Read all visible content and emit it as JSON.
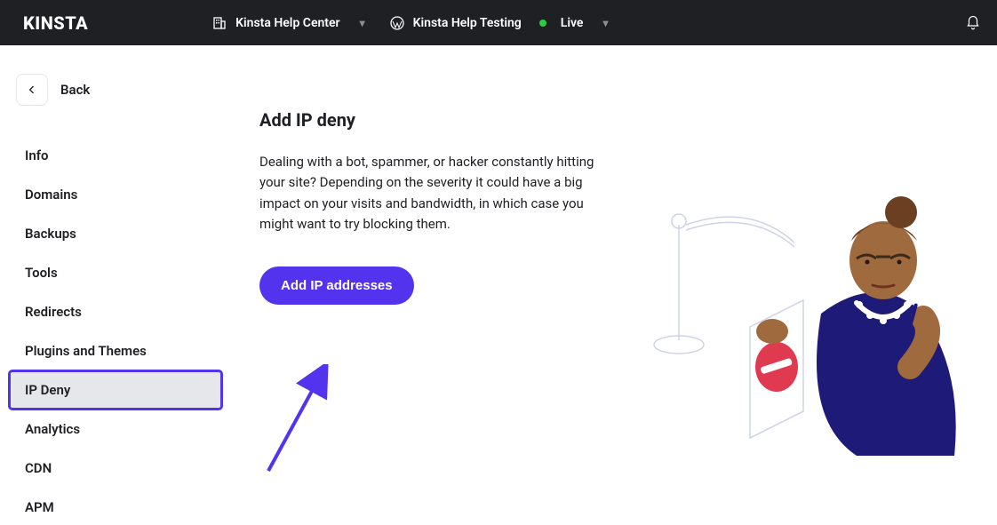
{
  "topbar": {
    "logo_text": "KINSTA",
    "company_selector": "Kinsta Help Center",
    "site_selector": "Kinsta Help Testing",
    "env_label": "Live"
  },
  "sidebar": {
    "back_label": "Back",
    "items": [
      {
        "label": "Info"
      },
      {
        "label": "Domains"
      },
      {
        "label": "Backups"
      },
      {
        "label": "Tools"
      },
      {
        "label": "Redirects"
      },
      {
        "label": "Plugins and Themes"
      },
      {
        "label": "IP Deny"
      },
      {
        "label": "Analytics"
      },
      {
        "label": "CDN"
      },
      {
        "label": "APM"
      }
    ],
    "active_index": 6
  },
  "main": {
    "title": "Add IP deny",
    "description": "Dealing with a bot, spammer, or hacker constantly hitting your site? Depending on the severity it could have a big impact on your visits and bandwidth, in which case you might want to try blocking them.",
    "cta_label": "Add IP addresses"
  },
  "colors": {
    "accent": "#5333ed",
    "topbar_bg": "#1f2024",
    "status_live": "#2ecc40"
  }
}
